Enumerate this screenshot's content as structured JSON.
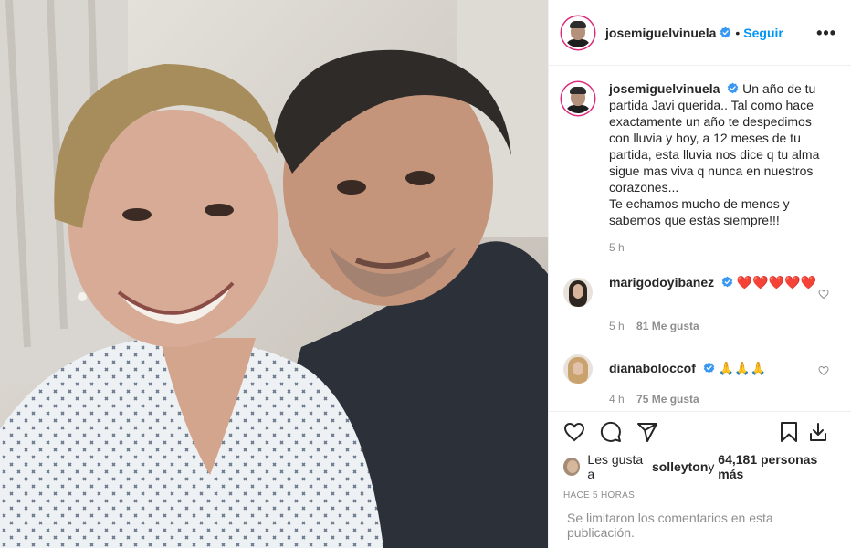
{
  "post": {
    "photo_alt": "",
    "author": "josemiguelvinuela",
    "dot": "•",
    "follow_label": "Seguir",
    "more_label": "•••"
  },
  "caption": {
    "author": "josemiguelvinuela",
    "text": "Un año de tu partida Javi querida.. Tal como hace exactamente un año te despedimos con lluvia y hoy, a 12 meses de tu partida, esta lluvia nos dice q tu alma sigue mas viva q nunca en nuestros corazones...",
    "text2": "Te echamos mucho de menos y sabemos que estás siempre!!!",
    "time": "5 h"
  },
  "comments": [
    {
      "author": "marigodoyibanez",
      "text": "❤️❤️❤️❤️❤️",
      "time": "5 h",
      "likes": "81 Me gusta"
    },
    {
      "author": "dianaboloccof",
      "text": "🙏🙏🙏",
      "time": "4 h",
      "likes": "75 Me gusta"
    }
  ],
  "likes": {
    "prefix": "Les gusta a ",
    "user": "solleyton",
    "middle": " y ",
    "count": "64,181 personas más"
  },
  "time_ago": "HACE 5 HORAS",
  "footer": "Se limitaron los comentarios en esta publicación.",
  "colors": {
    "link": "#0095f6",
    "heart": "#ed4956",
    "muted": "#8e8e8e",
    "ring": "#dd2a7b"
  },
  "icons": [
    "heart-icon",
    "comment-icon",
    "share-icon",
    "bookmark-icon",
    "download-icon",
    "verified-icon",
    "more-icon"
  ]
}
